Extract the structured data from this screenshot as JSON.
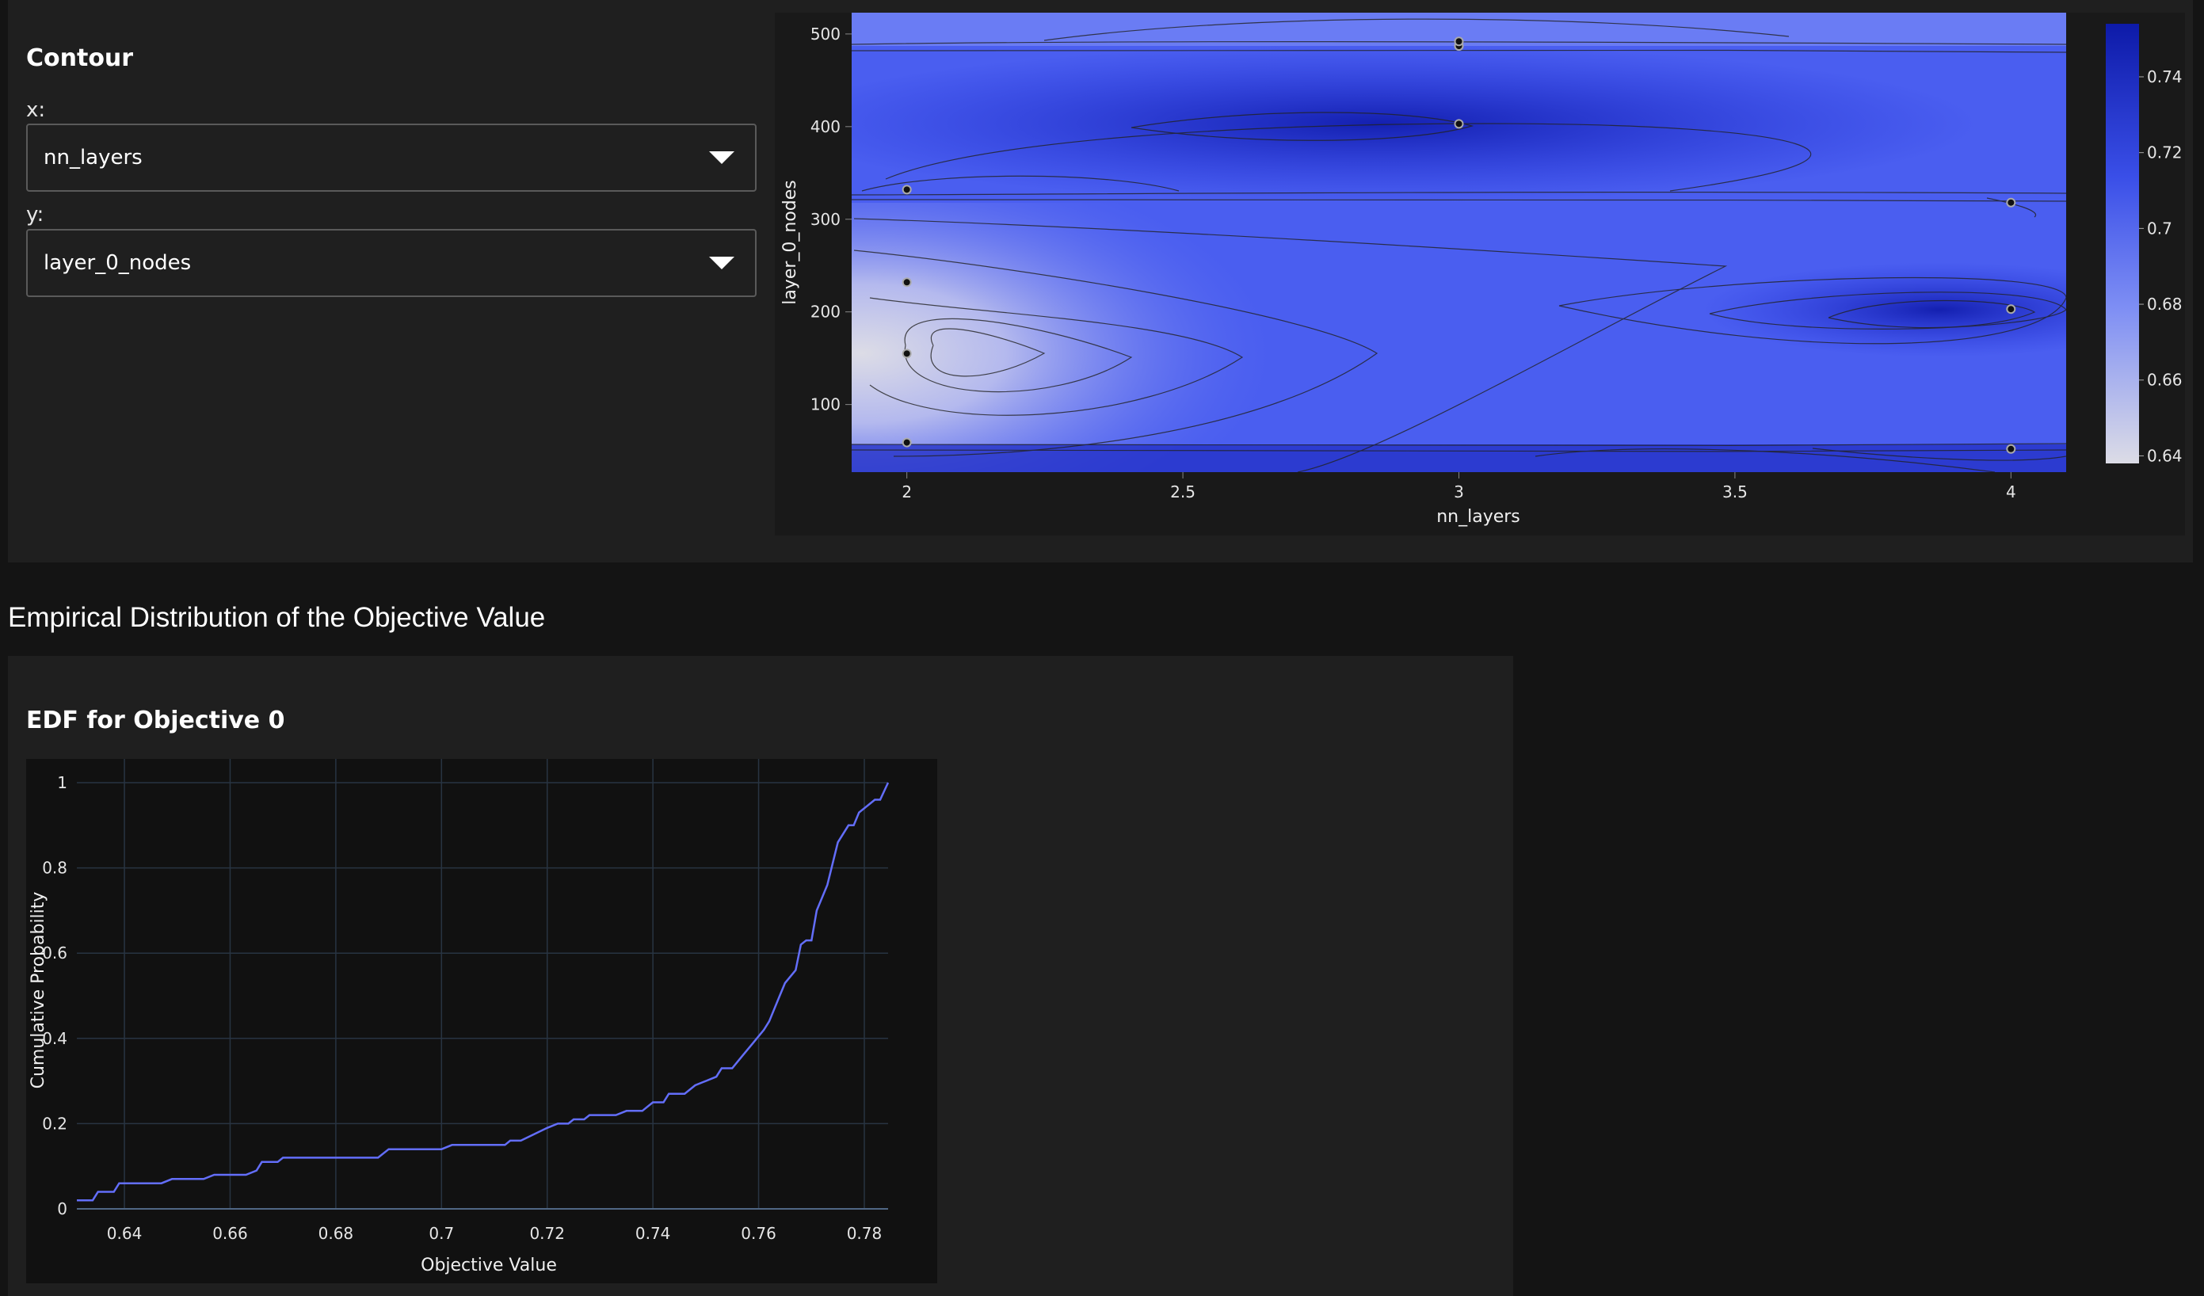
{
  "contour_panel": {
    "title": "Contour",
    "x_label": "x:",
    "x_value": "nn_layers",
    "y_label": "y:",
    "y_value": "layer_0_nodes"
  },
  "section_title": "Empirical Distribution of the Objective Value",
  "edf_panel": {
    "title": "EDF for Objective 0"
  },
  "colors": {
    "accent_line": "#636efa",
    "colorscale_low": "#dcdce6",
    "colorscale_high": "#0d1aa8"
  },
  "chart_data": [
    {
      "type": "contour",
      "xlabel": "nn_layers",
      "ylabel": "layer_0_nodes",
      "x_ticks": [
        "2",
        "2.5",
        "3",
        "3.5",
        "4"
      ],
      "x_tick_values": [
        2,
        2.5,
        3,
        3.5,
        4
      ],
      "y_ticks": [
        "100",
        "200",
        "300",
        "400",
        "500"
      ],
      "y_tick_values": [
        100,
        200,
        300,
        400,
        500
      ],
      "xlim": [
        1.9,
        4.1
      ],
      "ylim": [
        27,
        523
      ],
      "colorbar_ticks": [
        "0.74",
        "0.72",
        "0.7",
        "0.68",
        "0.66",
        "0.64"
      ],
      "colorbar_values": [
        0.74,
        0.72,
        0.7,
        0.68,
        0.66,
        0.64
      ],
      "colorbar_range": [
        0.638,
        0.754
      ],
      "points": [
        {
          "x": 2,
          "y": 59
        },
        {
          "x": 2,
          "y": 155
        },
        {
          "x": 2,
          "y": 232
        },
        {
          "x": 2,
          "y": 332
        },
        {
          "x": 3,
          "y": 403
        },
        {
          "x": 3,
          "y": 487
        },
        {
          "x": 3,
          "y": 492
        },
        {
          "x": 4,
          "y": 52
        },
        {
          "x": 4,
          "y": 203
        },
        {
          "x": 4,
          "y": 318
        }
      ]
    },
    {
      "type": "line",
      "xlabel": "Objective Value",
      "ylabel": "Cumulative Probability",
      "x_ticks": [
        "0.64",
        "0.66",
        "0.68",
        "0.7",
        "0.72",
        "0.74",
        "0.76",
        "0.78"
      ],
      "x_tick_values": [
        0.64,
        0.66,
        0.68,
        0.7,
        0.72,
        0.74,
        0.76,
        0.78
      ],
      "y_ticks": [
        "0",
        "0.2",
        "0.4",
        "0.6",
        "0.8",
        "1"
      ],
      "y_tick_values": [
        0,
        0.2,
        0.4,
        0.6,
        0.8,
        1
      ],
      "xlim": [
        0.631,
        0.7845
      ],
      "ylim": [
        0,
        1
      ],
      "series": [
        {
          "values": [
            [
              0.631,
              0.02
            ],
            [
              0.634,
              0.02
            ],
            [
              0.635,
              0.04
            ],
            [
              0.638,
              0.04
            ],
            [
              0.639,
              0.06
            ],
            [
              0.647,
              0.06
            ],
            [
              0.649,
              0.07
            ],
            [
              0.655,
              0.07
            ],
            [
              0.657,
              0.08
            ],
            [
              0.663,
              0.08
            ],
            [
              0.665,
              0.09
            ],
            [
              0.666,
              0.11
            ],
            [
              0.669,
              0.11
            ],
            [
              0.67,
              0.12
            ],
            [
              0.688,
              0.12
            ],
            [
              0.69,
              0.14
            ],
            [
              0.7,
              0.14
            ],
            [
              0.702,
              0.15
            ],
            [
              0.712,
              0.15
            ],
            [
              0.713,
              0.16
            ],
            [
              0.715,
              0.16
            ],
            [
              0.72,
              0.19
            ],
            [
              0.722,
              0.2
            ],
            [
              0.724,
              0.2
            ],
            [
              0.725,
              0.21
            ],
            [
              0.727,
              0.21
            ],
            [
              0.728,
              0.22
            ],
            [
              0.733,
              0.22
            ],
            [
              0.735,
              0.23
            ],
            [
              0.738,
              0.23
            ],
            [
              0.74,
              0.25
            ],
            [
              0.742,
              0.25
            ],
            [
              0.743,
              0.27
            ],
            [
              0.746,
              0.27
            ],
            [
              0.748,
              0.29
            ],
            [
              0.75,
              0.3
            ],
            [
              0.752,
              0.31
            ],
            [
              0.753,
              0.33
            ],
            [
              0.755,
              0.33
            ],
            [
              0.757,
              0.36
            ],
            [
              0.759,
              0.39
            ],
            [
              0.761,
              0.42
            ],
            [
              0.762,
              0.44
            ],
            [
              0.764,
              0.5
            ],
            [
              0.765,
              0.53
            ],
            [
              0.767,
              0.56
            ],
            [
              0.768,
              0.62
            ],
            [
              0.769,
              0.63
            ],
            [
              0.77,
              0.63
            ],
            [
              0.771,
              0.7
            ],
            [
              0.773,
              0.76
            ],
            [
              0.775,
              0.86
            ],
            [
              0.777,
              0.9
            ],
            [
              0.778,
              0.9
            ],
            [
              0.779,
              0.93
            ],
            [
              0.781,
              0.95
            ],
            [
              0.782,
              0.96
            ],
            [
              0.783,
              0.96
            ],
            [
              0.7845,
              1.0
            ]
          ]
        }
      ]
    }
  ]
}
